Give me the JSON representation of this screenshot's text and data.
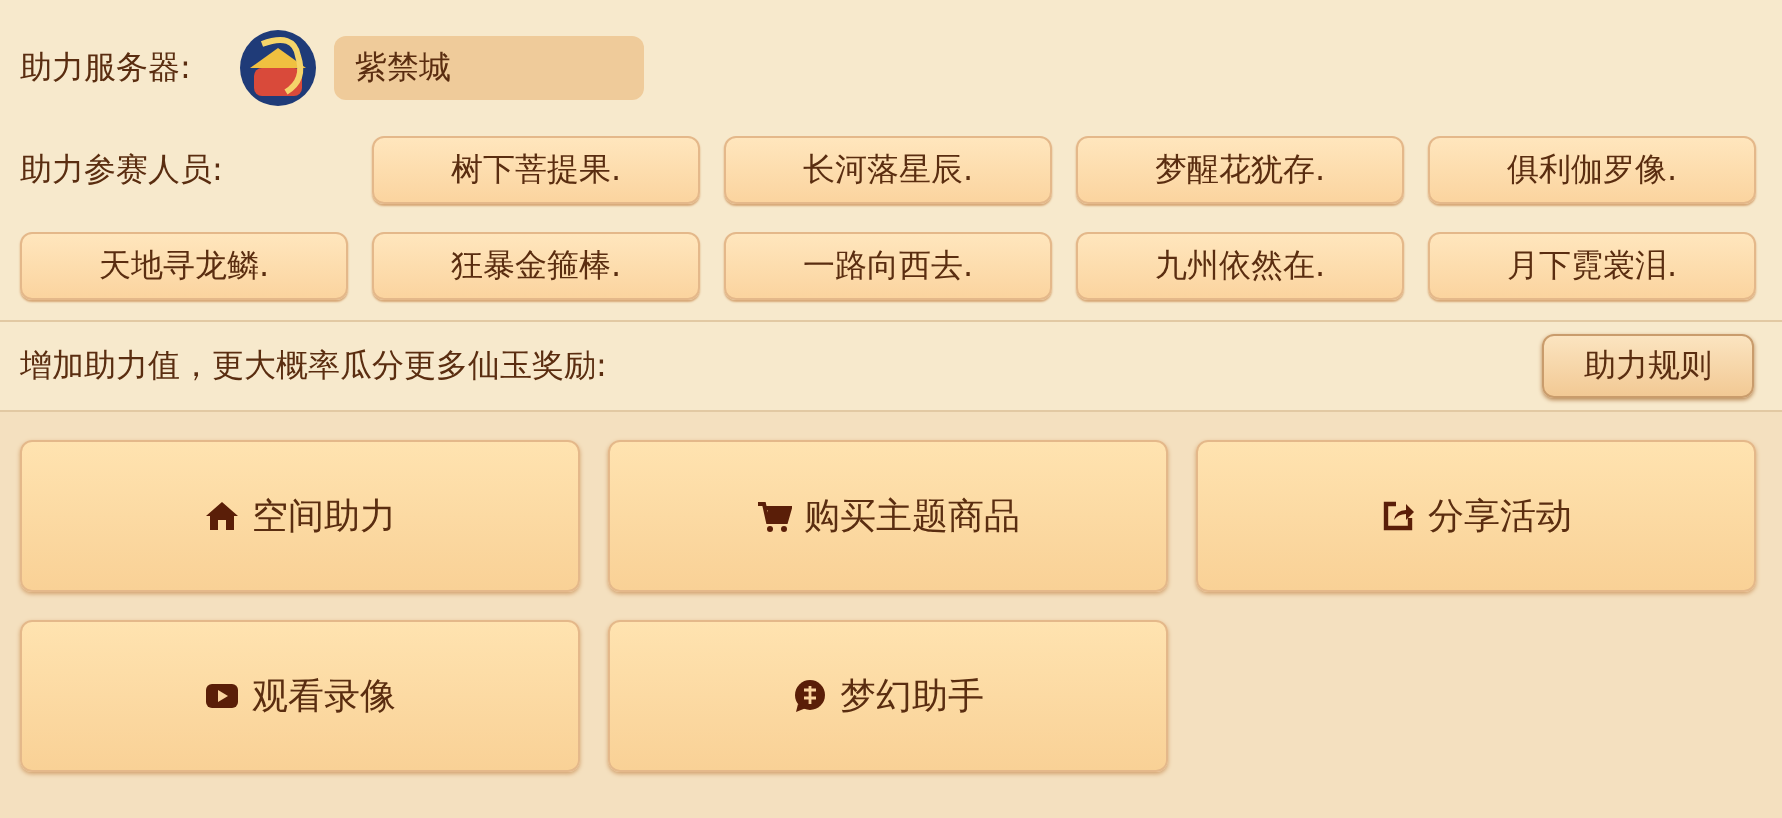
{
  "server": {
    "label": "助力服务器:",
    "value": "紫禁城"
  },
  "participants": {
    "label": "助力参赛人员:",
    "players": [
      "树下菩提果.",
      "长河落星辰.",
      "梦醒花犹存.",
      "俱利伽罗像.",
      "天地寻龙鳞.",
      "狂暴金箍棒.",
      "一路向西去.",
      "九州依然在.",
      "月下霓裳泪."
    ]
  },
  "boost": {
    "text": "增加助力值，更大概率瓜分更多仙玉奖励:",
    "rules_button": "助力规则"
  },
  "actions": [
    {
      "kind": "home",
      "label": "空间助力"
    },
    {
      "kind": "cart",
      "label": "购买主题商品"
    },
    {
      "kind": "share",
      "label": "分享活动"
    },
    {
      "kind": "video",
      "label": "观看录像"
    },
    {
      "kind": "chat",
      "label": "梦幻助手"
    }
  ]
}
